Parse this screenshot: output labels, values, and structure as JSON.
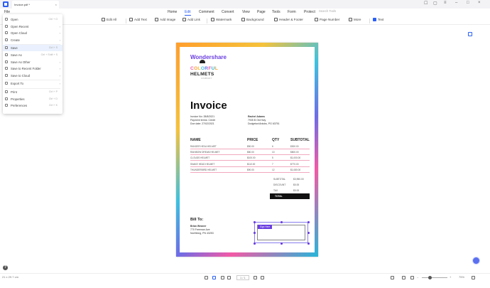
{
  "titlebar": {
    "tab_title": "Invoice.pdf *",
    "close_glyph": "×"
  },
  "menubar": {
    "file": "File",
    "items": [
      "Home",
      "Edit",
      "Comment",
      "Convert",
      "View",
      "Page",
      "Tools",
      "Form",
      "Protect"
    ],
    "active": "Edit",
    "search_placeholder": "Search Tools"
  },
  "toolbar": {
    "items": [
      "Edit All",
      "Add Text",
      "Add Image",
      "Add Link",
      "Watermark",
      "Background",
      "Header & Footer",
      "Page Number",
      "More",
      "Text"
    ]
  },
  "file_menu": {
    "items": [
      {
        "label": "Open",
        "shortcut": "Ctrl + O",
        "arrow": ""
      },
      {
        "label": "Open Recent",
        "shortcut": "",
        "arrow": "›"
      },
      {
        "label": "Open Cloud",
        "shortcut": "",
        "arrow": "›"
      },
      {
        "label": "Create",
        "shortcut": "",
        "arrow": "›"
      },
      {
        "label": "Save",
        "shortcut": "Ctrl + S",
        "arrow": ""
      },
      {
        "label": "Save As",
        "shortcut": "Ctrl + Shift + S",
        "arrow": ""
      },
      {
        "label": "Save As Other",
        "shortcut": "",
        "arrow": "›"
      },
      {
        "label": "Save to Recent Folder",
        "shortcut": "",
        "arrow": "›"
      },
      {
        "label": "Save to Cloud",
        "shortcut": "",
        "arrow": "›"
      },
      {
        "label": "Export To",
        "shortcut": "",
        "arrow": "›"
      },
      {
        "label": "Print",
        "shortcut": "Ctrl + P",
        "arrow": ""
      },
      {
        "label": "Properties",
        "shortcut": "Ctrl + D",
        "arrow": ""
      },
      {
        "label": "Preferences",
        "shortcut": "Ctrl + K",
        "arrow": ""
      }
    ],
    "selected": "Save"
  },
  "document": {
    "brand": "Wondershare",
    "logo_line1": "COLORFUL",
    "logo_line2": "HELMETS",
    "logo_sub": "COMPANY",
    "title": "Invoice",
    "invoice_no": "Invoice No: 28/8/2021",
    "payment_terms": "Payment terms: Credit",
    "due_date": "Due date: 27/02/2021",
    "customer_name": "Rachel Adams",
    "customer_addr1": "7935 B Old Hwy",
    "customer_addr2": "Dodgeton/Antoks, PG 63751",
    "headers": [
      "NAME",
      "PRICE",
      "QTY",
      "SUBTOTAL"
    ],
    "rows": [
      {
        "name": "RANGER HEXA HELMET",
        "price": "$50.00",
        "qty": "6",
        "subtotal": "$300.00"
      },
      {
        "name": "RAINBOW DREAM HELMET",
        "price": "$80.00",
        "qty": "10",
        "subtotal": "$800.00"
      },
      {
        "name": "CLOUDS HELMET",
        "price": "$100.00",
        "qty": "5",
        "subtotal": "$1,000.00"
      },
      {
        "name": "SNAKE HEAD HELMET",
        "price": "$110.00",
        "qty": "7",
        "subtotal": "$770.00"
      },
      {
        "name": "THUNDERBIRD HELMET",
        "price": "$90.00",
        "qty": "12",
        "subtotal": "$1,080.00"
      }
    ],
    "subtotal_label": "SUBTOTAL",
    "subtotal_value": "$3,950.00",
    "discount_label": "DISCOUNT",
    "discount_value": "$0.00",
    "tax_label": "TAX",
    "tax_value": "$0.00",
    "total_label": "TOTAL",
    "bill_to": "Bill To:",
    "bill_name": "Brian Weaver",
    "bill_addr1": "770 Freeman Ave",
    "bill_addr2": "Northhing, PN 43253",
    "sign_tag": "Sign Here"
  },
  "statusbar": {
    "page_size": "21 x 29.7 cm",
    "page_indicator": "1 / 1",
    "zoom": "75%"
  },
  "colors": {
    "accent": "#2b5ff5",
    "brand_purple": "#6a3ee0"
  }
}
